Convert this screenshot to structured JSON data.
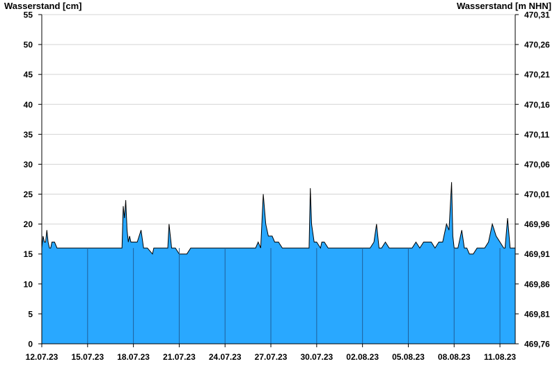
{
  "chart_data": {
    "type": "area",
    "ylabel_left": "Wasserstand [cm]",
    "ylabel_right": "Wasserstand [m NHN]",
    "ylim_left": [
      0,
      55
    ],
    "ylim_right": [
      469.76,
      470.31
    ],
    "yticks_left": [
      "0",
      "5",
      "10",
      "15",
      "20",
      "25",
      "30",
      "35",
      "40",
      "45",
      "50",
      "55"
    ],
    "yticks_right": [
      "469,76",
      "469,81",
      "469,86",
      "469,91",
      "469,96",
      "470,01",
      "470,06",
      "470,11",
      "470,16",
      "470,21",
      "470,26",
      "470,31"
    ],
    "x_start": "2023-07-12",
    "x_end": "2023-08-12",
    "xticks": [
      "12.07.23",
      "15.07.23",
      "18.07.23",
      "21.07.23",
      "24.07.23",
      "27.07.23",
      "30.07.23",
      "02.08.23",
      "05.08.23",
      "08.08.23",
      "11.08.23"
    ],
    "grid": true,
    "fill_color": "#29a8ff",
    "line_color": "#000000",
    "series": [
      {
        "x": [
          "2023-07-12 00:00",
          "2023-07-12 02:00",
          "2023-07-12 04:00",
          "2023-07-12 06:00",
          "2023-07-12 08:00",
          "2023-07-12 10:00",
          "2023-07-12 12:00",
          "2023-07-12 14:00",
          "2023-07-12 16:00",
          "2023-07-12 18:00",
          "2023-07-12 20:00",
          "2023-07-13 00:00",
          "2023-07-13 06:00",
          "2023-07-13 12:00",
          "2023-07-13 18:00",
          "2023-07-14 00:00",
          "2023-07-17 06:00",
          "2023-07-17 08:00",
          "2023-07-17 10:00",
          "2023-07-17 12:00",
          "2023-07-17 14:00",
          "2023-07-17 16:00",
          "2023-07-17 18:00",
          "2023-07-17 20:00",
          "2023-07-18 00:00",
          "2023-07-18 02:00",
          "2023-07-18 06:00",
          "2023-07-18 12:00",
          "2023-07-18 16:00",
          "2023-07-18 18:00",
          "2023-07-18 22:00",
          "2023-07-19 06:00",
          "2023-07-19 08:00",
          "2023-07-19 12:00",
          "2023-07-20 06:00",
          "2023-07-20 08:00",
          "2023-07-20 12:00",
          "2023-07-20 18:00",
          "2023-07-21 00:00",
          "2023-07-21 12:00",
          "2023-07-21 18:00",
          "2023-07-26 00:00",
          "2023-07-26 04:00",
          "2023-07-26 08:00",
          "2023-07-26 12:00",
          "2023-07-26 16:00",
          "2023-07-26 20:00",
          "2023-07-27 02:00",
          "2023-07-27 06:00",
          "2023-07-27 12:00",
          "2023-07-27 18:00",
          "2023-07-28 00:00",
          "2023-07-29 12:00",
          "2023-07-29 14:00",
          "2023-07-29 16:00",
          "2023-07-29 20:00",
          "2023-07-30 00:00",
          "2023-07-30 06:00",
          "2023-07-30 08:00",
          "2023-07-30 12:00",
          "2023-07-30 18:00",
          "2023-07-31 06:00",
          "2023-07-31 12:00",
          "2023-08-02 12:00",
          "2023-08-02 18:00",
          "2023-08-02 22:00",
          "2023-08-03 02:00",
          "2023-08-03 06:00",
          "2023-08-03 12:00",
          "2023-08-03 18:00",
          "2023-08-04 00:00",
          "2023-08-04 12:00",
          "2023-08-05 06:00",
          "2023-08-05 12:00",
          "2023-08-05 18:00",
          "2023-08-06 00:00",
          "2023-08-06 12:00",
          "2023-08-06 18:00",
          "2023-08-07 00:00",
          "2023-08-07 06:00",
          "2023-08-07 12:00",
          "2023-08-07 16:00",
          "2023-08-07 20:00",
          "2023-08-07 22:00",
          "2023-08-08 00:00",
          "2023-08-08 04:00",
          "2023-08-08 06:00",
          "2023-08-08 12:00",
          "2023-08-08 16:00",
          "2023-08-08 20:00",
          "2023-08-09 00:00",
          "2023-08-09 06:00",
          "2023-08-09 12:00",
          "2023-08-10 00:00",
          "2023-08-10 06:00",
          "2023-08-10 12:00",
          "2023-08-10 18:00",
          "2023-08-11 00:00",
          "2023-08-11 06:00",
          "2023-08-11 08:00",
          "2023-08-11 12:00",
          "2023-08-11 16:00",
          "2023-08-12 00:00"
        ],
        "y": [
          16,
          18,
          17,
          17,
          19,
          17,
          16,
          16,
          17,
          17,
          17,
          16,
          16,
          16,
          16,
          16,
          16,
          23,
          21,
          24,
          19,
          17,
          18,
          17,
          17,
          17,
          17,
          19,
          16,
          16,
          16,
          15,
          16,
          16,
          16,
          20,
          16,
          16,
          15,
          15,
          16,
          16,
          17,
          16,
          25,
          20,
          18,
          18,
          17,
          17,
          16,
          16,
          16,
          26,
          20,
          17,
          17,
          16,
          17,
          17,
          16,
          16,
          16,
          16,
          17,
          20,
          16,
          16,
          17,
          16,
          16,
          16,
          16,
          17,
          16,
          17,
          17,
          16,
          17,
          17,
          20,
          19,
          27,
          18,
          16,
          16,
          16,
          19,
          16,
          16,
          15,
          15,
          16,
          16,
          17,
          20,
          18,
          17,
          16,
          16,
          21,
          16,
          16
        ]
      }
    ]
  }
}
